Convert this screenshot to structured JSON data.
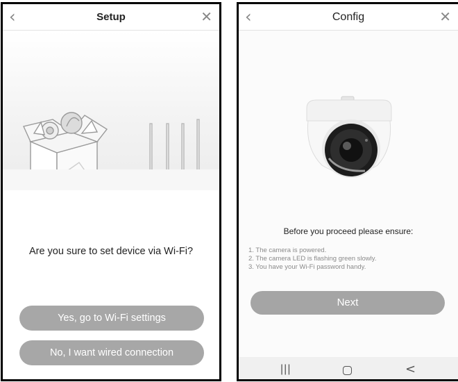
{
  "left": {
    "title": "Setup",
    "back_icon": "chevron-left-icon",
    "close_icon": "close-icon",
    "question": "Are you sure to set device via Wi-Fi?",
    "primary_button": "Yes, go to Wi-Fi settings",
    "secondary_button": "No, I want wired connection"
  },
  "right": {
    "title": "Config",
    "back_icon": "chevron-left-icon",
    "close_icon": "close-icon",
    "ensure_title": "Before you proceed please ensure:",
    "ensure_items": [
      "1. The camera is powered.",
      "2. The camera LED is flashing green slowly.",
      "3. You have your Wi-Fi password handy."
    ],
    "next_button": "Next",
    "nav": {
      "recents": "|||",
      "home": "",
      "back": "<"
    }
  },
  "colors": {
    "button_gray": "#a7a7a7",
    "icon_gray": "#888888"
  }
}
